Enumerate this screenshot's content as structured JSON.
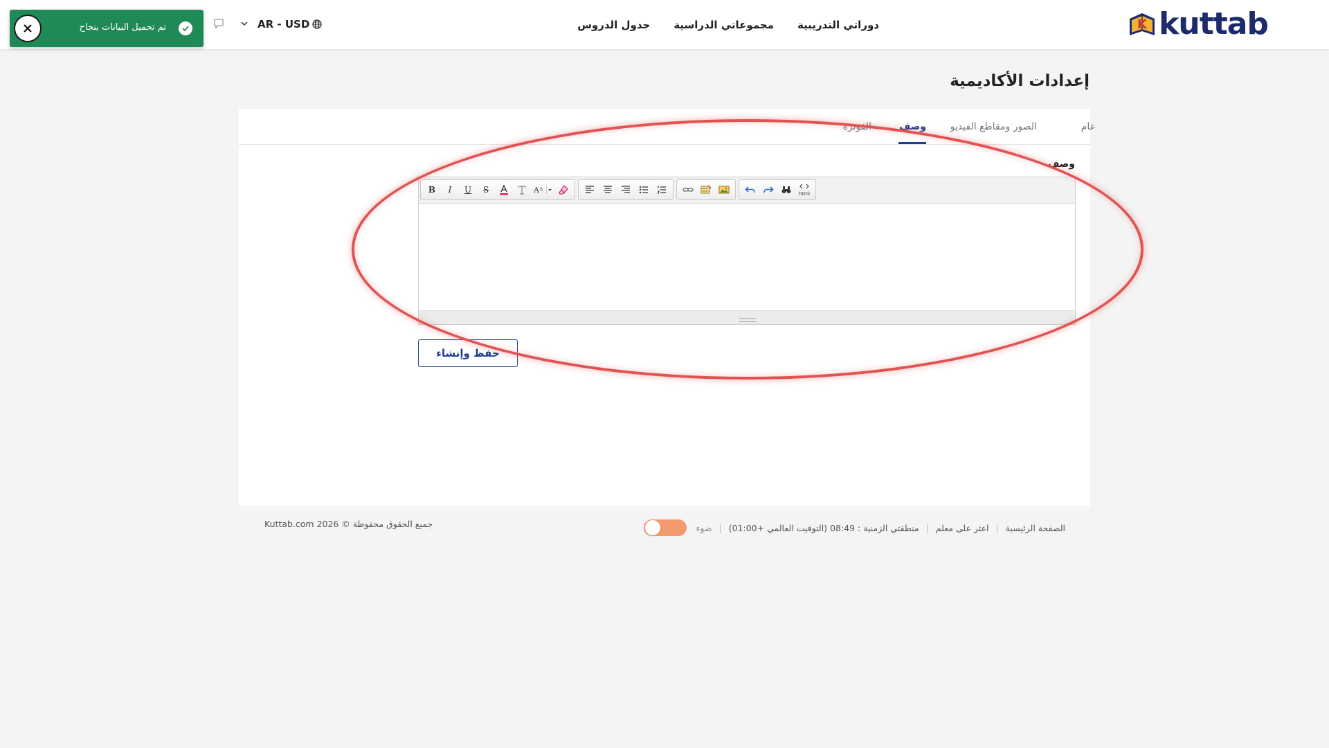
{
  "header": {
    "logo_text": "kuttab",
    "nav": [
      {
        "label": "جدول الدروس"
      },
      {
        "label": "مجموعاتي الدراسية"
      },
      {
        "label": "دوراتي التدريبية"
      }
    ],
    "language_currency": "AR - USD"
  },
  "toast": {
    "message": "تم تحميل البيانات بنجاح",
    "color": "#1f8a55"
  },
  "page": {
    "title": "إعدادات الأكاديمية"
  },
  "tabs": [
    {
      "label": "عام",
      "active": false
    },
    {
      "label": "الصور ومقاطع الفيديو",
      "active": false
    },
    {
      "label": "وصف",
      "active": true
    },
    {
      "label": "الفوترة",
      "active": false
    }
  ],
  "form": {
    "field_label": "وصف",
    "editor_value": "",
    "html_button_label": "html",
    "save_button_label": "حفظ وإنشاء"
  },
  "footer": {
    "links": [
      {
        "label": "الصفحة الرئيسية"
      },
      {
        "label": "اعثر على معلم"
      }
    ],
    "timezone": "منطقتي الزمنية : 08:49 (التوقيت العالمي +01:00)",
    "theme_label": "ضوء",
    "copyright": "جميع الحقوق محفوظة © 2026 Kuttab.com"
  },
  "colors": {
    "brand": "#1d2a6b",
    "accent": "#1d3e8f",
    "highlight": "#e05353",
    "toggle": "#f39a6e"
  }
}
